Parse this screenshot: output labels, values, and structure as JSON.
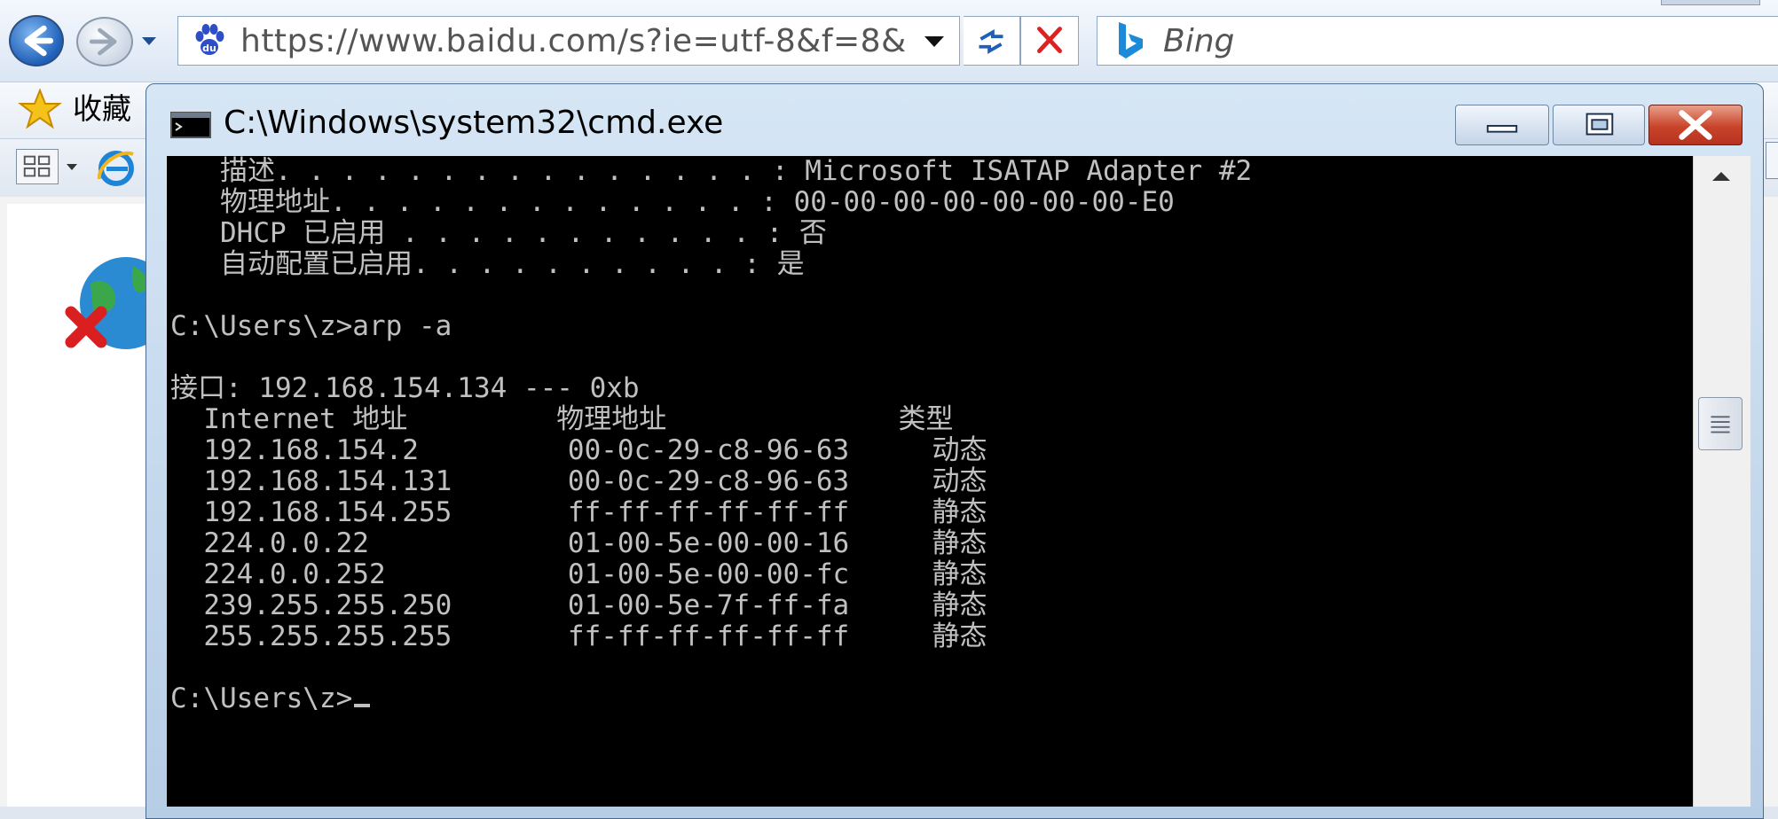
{
  "browser": {
    "address_url": "https://www.baidu.com/s?ie=utf-8&f=8&",
    "search_provider": "Bing",
    "favorites_label": "收藏"
  },
  "cmd": {
    "title": "C:\\Windows\\system32\\cmd.exe",
    "lines": [
      "   描述. . . . . . . . . . . . . . . : Microsoft ISATAP Adapter #2",
      "   物理地址. . . . . . . . . . . . . : 00-00-00-00-00-00-00-E0",
      "   DHCP 已启用 . . . . . . . . . . . : 否",
      "   自动配置已启用. . . . . . . . . . : 是",
      "",
      "C:\\Users\\z>arp -a",
      "",
      "接口: 192.168.154.134 --- 0xb",
      "  Internet 地址         物理地址              类型",
      "  192.168.154.2         00-0c-29-c8-96-63     动态",
      "  192.168.154.131       00-0c-29-c8-96-63     动态",
      "  192.168.154.255       ff-ff-ff-ff-ff-ff     静态",
      "  224.0.0.22            01-00-5e-00-00-16     静态",
      "  224.0.0.252           01-00-5e-00-00-fc     静态",
      "  239.255.255.250       01-00-5e-7f-ff-fa     静态",
      "  255.255.255.255       ff-ff-ff-ff-ff-ff     静态",
      "",
      "C:\\Users\\z>"
    ]
  },
  "colors": {
    "console_bg": "#000000",
    "console_text": "#c0c0c0",
    "close_button": "#c9432a",
    "window_frame": "#b6cde6"
  }
}
